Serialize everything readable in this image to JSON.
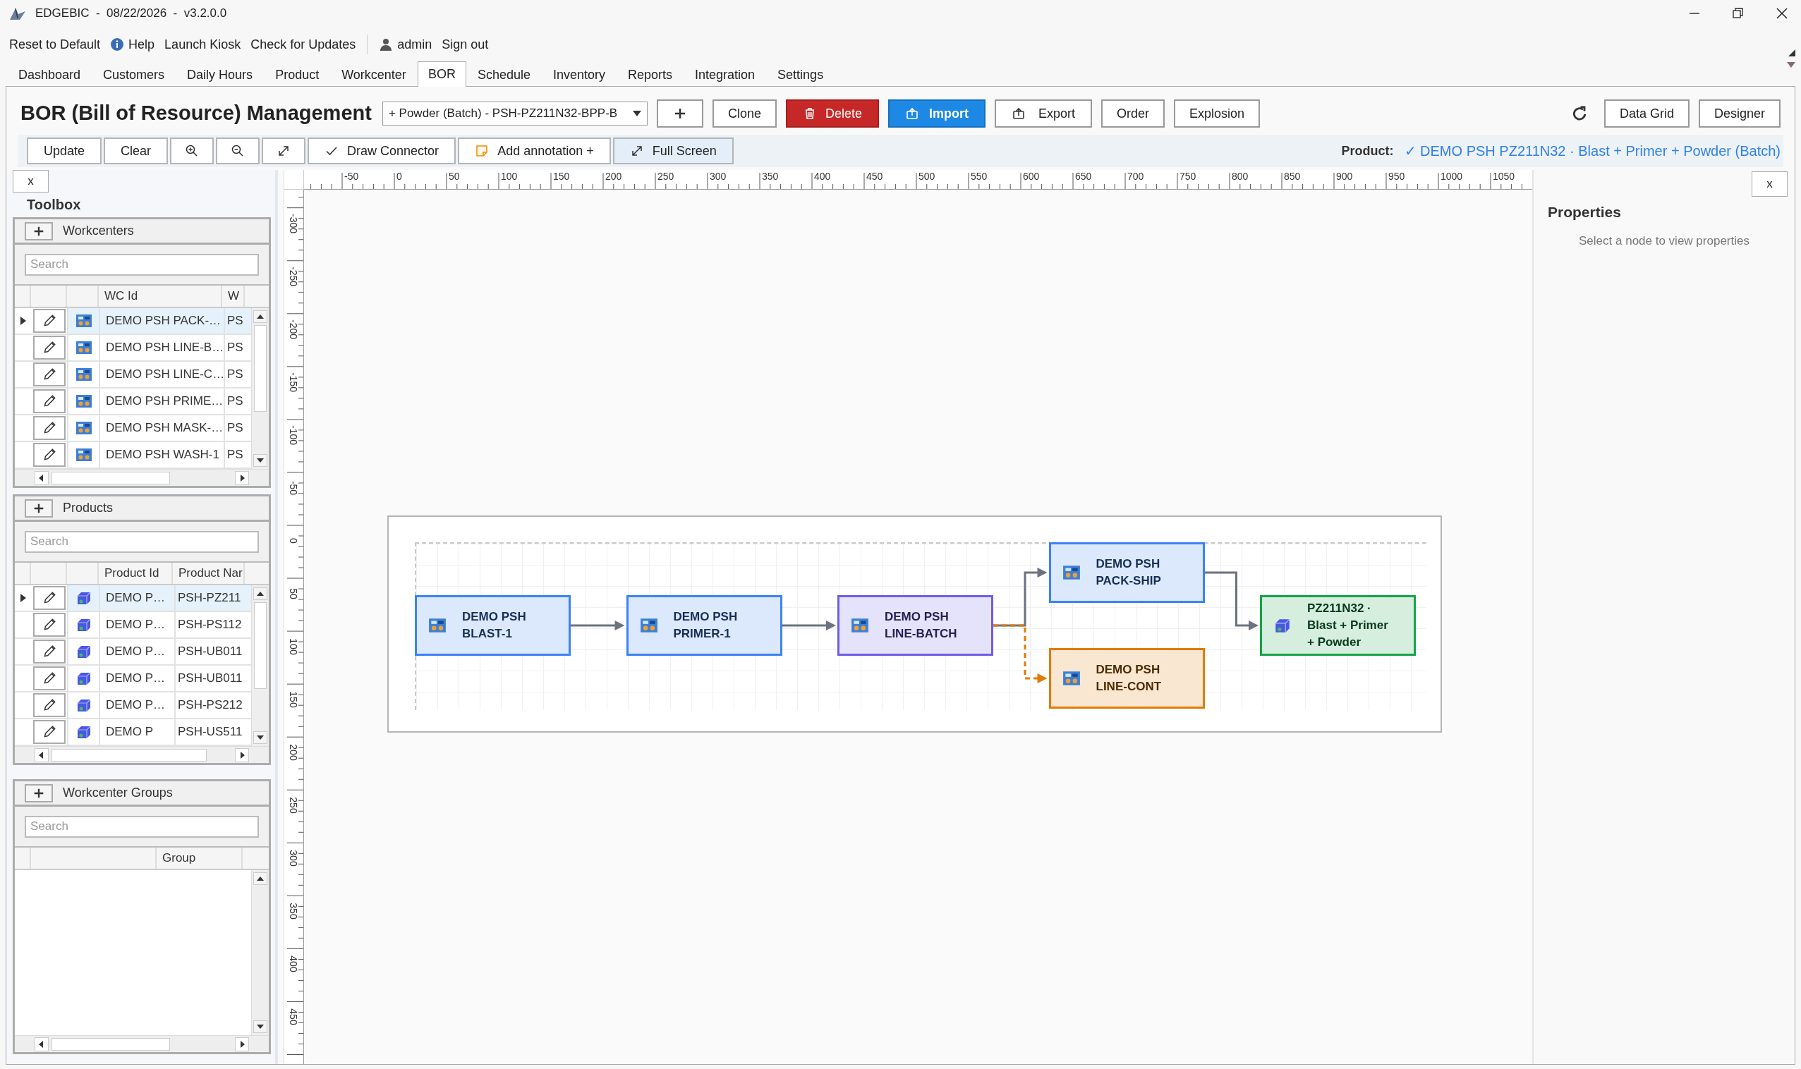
{
  "window": {
    "title": "EDGEBIC  -  08/22/2026  -  v3.2.0.0"
  },
  "menu": [
    {
      "kind": "text",
      "label": "Reset to Default"
    },
    {
      "kind": "info",
      "label": "Help"
    },
    {
      "kind": "text",
      "label": "Launch Kiosk"
    },
    {
      "kind": "text",
      "label": "Check for Updates"
    },
    {
      "kind": "user",
      "label": "admin"
    },
    {
      "kind": "text",
      "label": "Sign out"
    }
  ],
  "tabs": [
    {
      "label": "Dashboard",
      "selected": false
    },
    {
      "label": "Customers",
      "selected": false
    },
    {
      "label": "Daily Hours",
      "selected": false
    },
    {
      "label": "Product",
      "selected": false
    },
    {
      "label": "Workcenter",
      "selected": false
    },
    {
      "label": "BOR",
      "selected": true
    },
    {
      "label": "Schedule",
      "selected": false
    },
    {
      "label": "Inventory",
      "selected": false
    },
    {
      "label": "Reports",
      "selected": false
    },
    {
      "label": "Integration",
      "selected": false
    },
    {
      "label": "Settings",
      "selected": false
    }
  ],
  "header": {
    "title": "BOR (Bill of Resource) Management",
    "bor_select": {
      "value": "+ Powder (Batch) - PSH-PZ211N32-BPP-B"
    },
    "buttons": [
      {
        "kind": "add"
      },
      {
        "kind": "plain",
        "label": "Clone"
      },
      {
        "kind": "delete",
        "label": "Delete"
      },
      {
        "kind": "import",
        "label": "Import"
      },
      {
        "kind": "export",
        "label": "Export"
      },
      {
        "kind": "plain",
        "label": "Order"
      },
      {
        "kind": "plain",
        "label": "Explosion"
      }
    ],
    "right_buttons": [
      {
        "kind": "refresh"
      },
      {
        "kind": "plain",
        "label": "Data Grid"
      },
      {
        "kind": "plain",
        "label": "Designer"
      }
    ]
  },
  "toolbar": {
    "items": [
      {
        "kind": "text",
        "label": "Update",
        "selected": false
      },
      {
        "kind": "text",
        "label": "Clear",
        "selected": false
      },
      {
        "kind": "zoom-in",
        "selected": false
      },
      {
        "kind": "zoom-out",
        "selected": false
      },
      {
        "kind": "fit",
        "selected": false
      },
      {
        "kind": "connector",
        "label": "Draw Connector",
        "selected": false
      },
      {
        "kind": "annotation",
        "label": "Add annotation +",
        "selected": false
      },
      {
        "kind": "fullscreen",
        "label": "Full Screen",
        "selected": true
      }
    ],
    "product_label": "Product:",
    "product_value": "✓ DEMO PSH PZ211N32 · Blast + Primer + Powder (Batch)"
  },
  "toolbox": {
    "close": "x",
    "title": "Toolbox",
    "sections": [
      {
        "kind": "workcenter",
        "title": "Workcenters",
        "search": {
          "placeholder": "Search"
        },
        "columns": [
          "WC Id",
          "W"
        ],
        "rows": [
          {
            "selected": true,
            "cells": [
              "DEMO PSH PACK-…",
              "PS"
            ]
          },
          {
            "selected": false,
            "cells": [
              "DEMO PSH LINE-B…",
              "PS"
            ]
          },
          {
            "selected": false,
            "cells": [
              "DEMO PSH LINE-C…",
              "PS"
            ]
          },
          {
            "selected": false,
            "cells": [
              "DEMO PSH PRIME…",
              "PS"
            ]
          },
          {
            "selected": false,
            "cells": [
              "DEMO PSH MASK-…",
              "PS"
            ]
          },
          {
            "selected": false,
            "cells": [
              "DEMO PSH WASH-1",
              "PS"
            ]
          }
        ]
      },
      {
        "kind": "product",
        "title": "Products",
        "search": {
          "placeholder": "Search"
        },
        "columns": [
          "Product Id",
          "Product Nar"
        ],
        "rows": [
          {
            "selected": true,
            "cells": [
              "DEMO P…",
              "PSH-PZ211"
            ]
          },
          {
            "selected": false,
            "cells": [
              "DEMO P…",
              "PSH-PS112"
            ]
          },
          {
            "selected": false,
            "cells": [
              "DEMO P…",
              "PSH-UB011"
            ]
          },
          {
            "selected": false,
            "cells": [
              "DEMO P…",
              "PSH-UB011"
            ]
          },
          {
            "selected": false,
            "cells": [
              "DEMO P…",
              "PSH-PS212"
            ]
          },
          {
            "selected": false,
            "cells": [
              "DEMO P",
              "PSH-US511"
            ]
          }
        ]
      },
      {
        "kind": "group",
        "title": "Workcenter Groups",
        "search": {
          "placeholder": "Search"
        },
        "columns": [
          "Group"
        ]
      }
    ]
  },
  "ruler": {
    "x_labels": [
      "-50",
      "0",
      "50",
      "100",
      "150",
      "200",
      "250",
      "300",
      "350",
      "400",
      "450",
      "500",
      "550",
      "600",
      "650",
      "700",
      "750",
      "800",
      "850",
      "900",
      "950",
      "1000",
      "1050"
    ],
    "y_labels": [
      "-300",
      "-250",
      "-200",
      "-150",
      "-100",
      "-50",
      "0",
      "50",
      "100",
      "150",
      "200",
      "250",
      "300",
      "350",
      "400",
      "450"
    ]
  },
  "diagram": {
    "nodes": [
      {
        "kind": "workcenter",
        "label": [
          "DEMO PSH",
          "BLAST-1"
        ],
        "color": "#3b82f6"
      },
      {
        "kind": "workcenter",
        "label": [
          "DEMO PSH",
          "PRIMER-1"
        ],
        "color": "#3b82f6"
      },
      {
        "kind": "workcenter",
        "label": [
          "DEMO PSH",
          "LINE-BATCH"
        ],
        "color": "#6d5ce8"
      },
      {
        "kind": "workcenter",
        "label": [
          "DEMO PSH",
          "PACK-SHIP"
        ],
        "color": "#3b82f6"
      },
      {
        "kind": "workcenter",
        "label": [
          "DEMO PSH",
          "LINE-CONT"
        ],
        "color": "#e07b00"
      },
      {
        "kind": "product",
        "label": [
          "PZ211N32 ·",
          "Blast + Primer",
          "+ Powder"
        ],
        "color": "#16a34a"
      }
    ],
    "edges": [
      {
        "dashed": false,
        "color": "#6b7280"
      },
      {
        "dashed": false,
        "color": "#6b7280"
      },
      {
        "dashed": false,
        "color": "#6b7280"
      },
      {
        "dashed": true,
        "color": "#e07b00"
      },
      {
        "dashed": false,
        "color": "#6b7280"
      }
    ]
  },
  "properties": {
    "close": "x",
    "title": "Properties",
    "hint": "Select a node to view properties"
  }
}
